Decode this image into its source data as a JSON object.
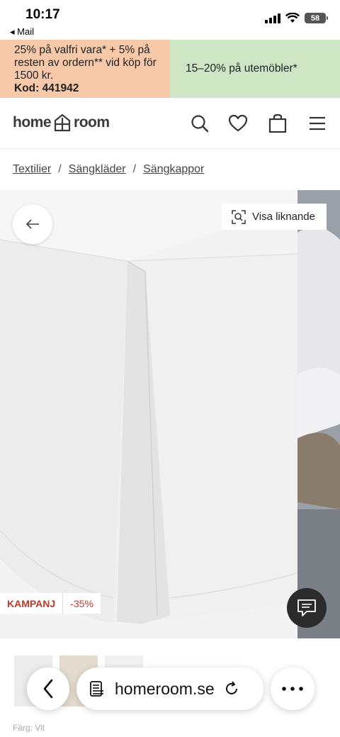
{
  "status_bar": {
    "time": "10:17",
    "back_app": "◂ Mail",
    "battery": "58"
  },
  "promo": {
    "left_text": "25% på valfri vara* + 5% på resten av ordern** vid köp för 1500 kr.",
    "left_code": "Kod: 441942",
    "right_text": "15–20% på utemöbler*",
    "left_color": "#f7c9a8",
    "right_color": "#cfe6c4"
  },
  "header": {
    "logo_left": "home",
    "logo_right": "room",
    "icons": [
      "search-icon",
      "heart-icon",
      "bag-icon",
      "menu-icon"
    ]
  },
  "breadcrumb": {
    "items": [
      "Textilier",
      "Sängkläder",
      "Sängkappor"
    ],
    "separator": "/"
  },
  "product": {
    "visa_label": "Visa liknande",
    "badge_label": "KAMPANJ",
    "discount": "-35%",
    "color_label": "Färg: Vit",
    "accent_color": "#c0392b"
  },
  "browser": {
    "url": "homeroom.se"
  }
}
